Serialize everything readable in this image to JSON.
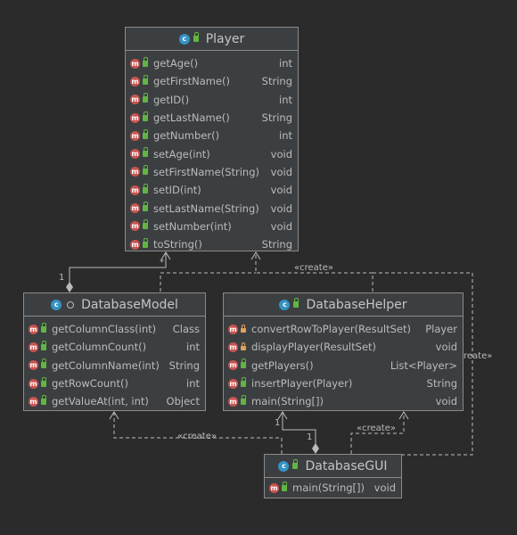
{
  "classes": {
    "player": {
      "name": "Player",
      "kind_icon": "class-icon",
      "members": [
        {
          "name": "getAge()",
          "type": "int",
          "visibility": "public"
        },
        {
          "name": "getFirstName()",
          "type": "String",
          "visibility": "public"
        },
        {
          "name": "getID()",
          "type": "int",
          "visibility": "public"
        },
        {
          "name": "getLastName()",
          "type": "String",
          "visibility": "public"
        },
        {
          "name": "getNumber()",
          "type": "int",
          "visibility": "public"
        },
        {
          "name": "setAge(int)",
          "type": "void",
          "visibility": "public"
        },
        {
          "name": "setFirstName(String)",
          "type": "void",
          "visibility": "public"
        },
        {
          "name": "setID(int)",
          "type": "void",
          "visibility": "public"
        },
        {
          "name": "setLastName(String)",
          "type": "void",
          "visibility": "public"
        },
        {
          "name": "setNumber(int)",
          "type": "void",
          "visibility": "public"
        },
        {
          "name": "toString()",
          "type": "String",
          "visibility": "public"
        }
      ]
    },
    "database_model": {
      "name": "DatabaseModel",
      "kind_icon": "class-icon",
      "members": [
        {
          "name": "getColumnClass(int)",
          "type": "Class",
          "visibility": "public"
        },
        {
          "name": "getColumnCount()",
          "type": "int",
          "visibility": "public"
        },
        {
          "name": "getColumnName(int)",
          "type": "String",
          "visibility": "public"
        },
        {
          "name": "getRowCount()",
          "type": "int",
          "visibility": "public"
        },
        {
          "name": "getValueAt(int, int)",
          "type": "Object",
          "visibility": "public"
        }
      ]
    },
    "database_helper": {
      "name": "DatabaseHelper",
      "kind_icon": "class-icon",
      "members": [
        {
          "name": "convertRowToPlayer(ResultSet)",
          "type": "Player",
          "visibility": "private"
        },
        {
          "name": "displayPlayer(ResultSet)",
          "type": "void",
          "visibility": "private"
        },
        {
          "name": "getPlayers()",
          "type": "List<Player>",
          "visibility": "public"
        },
        {
          "name": "insertPlayer(Player)",
          "type": "String",
          "visibility": "public"
        },
        {
          "name": "main(String[])",
          "type": "void",
          "visibility": "public"
        }
      ]
    },
    "database_gui": {
      "name": "DatabaseGUI",
      "kind_icon": "class-icon",
      "members": [
        {
          "name": "main(String[])",
          "type": "void",
          "visibility": "public"
        }
      ]
    }
  },
  "edge_labels": {
    "model_player_mult_one": "1",
    "model_player_mult_star": "*",
    "helper_create_player": "«create»",
    "gui_create_model": "«create»",
    "gui_create_helper": "«create»",
    "gui_create_player": "reate»",
    "gui_helper_mult_left": "1",
    "gui_helper_mult_right": "1"
  },
  "colors": {
    "background": "#2b2b2b",
    "node_fill": "#3c3f41",
    "border": "#8a8a8a",
    "method_icon": "#c75450",
    "class_icon": "#3592c4",
    "public_lock": "#62b543",
    "private_lock": "#e0a25b"
  }
}
